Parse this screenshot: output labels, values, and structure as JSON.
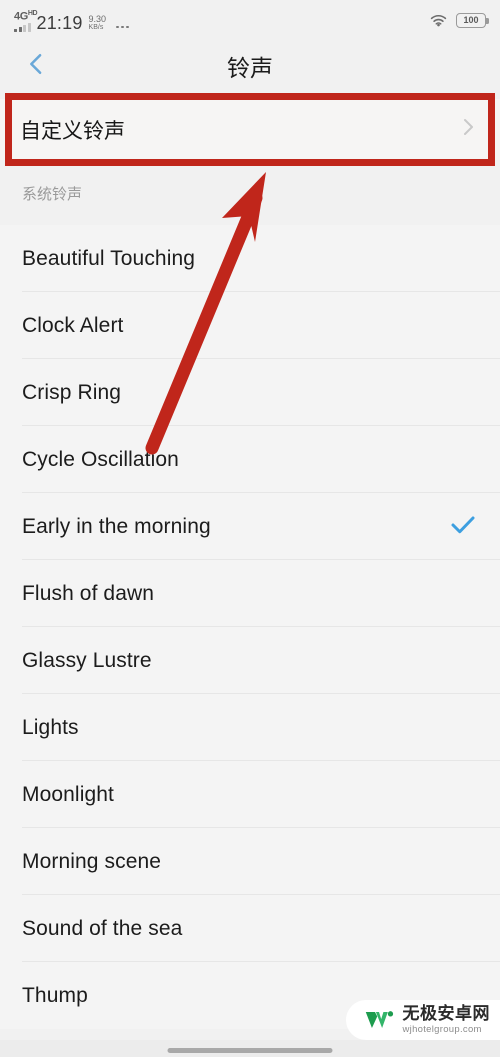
{
  "status_bar": {
    "network_type": "4G",
    "network_suffix": "HD",
    "time": "21:19",
    "speed_value": "9.30",
    "speed_unit": "KB/s",
    "overflow_icon": "more-dots-icon",
    "wifi_icon": "wifi-icon",
    "battery_level": "100"
  },
  "header": {
    "back_icon": "chevron-left-icon",
    "title": "铃声"
  },
  "custom_ringtone": {
    "label": "自定义铃声",
    "chevron_icon": "chevron-right-icon"
  },
  "section": {
    "header": "系统铃声"
  },
  "ringtones": [
    {
      "name": "Beautiful Touching",
      "selected": false
    },
    {
      "name": "Clock Alert",
      "selected": false
    },
    {
      "name": "Crisp Ring",
      "selected": false
    },
    {
      "name": "Cycle Oscillation",
      "selected": false
    },
    {
      "name": "Early in the morning",
      "selected": true
    },
    {
      "name": "Flush of dawn",
      "selected": false
    },
    {
      "name": "Glassy Lustre",
      "selected": false
    },
    {
      "name": "Lights",
      "selected": false
    },
    {
      "name": "Moonlight",
      "selected": false
    },
    {
      "name": "Morning scene",
      "selected": false
    },
    {
      "name": "Sound of the sea",
      "selected": false
    },
    {
      "name": "Thump",
      "selected": false
    }
  ],
  "annotations": {
    "highlight_box_color": "#c0261b",
    "arrow_color": "#c0261b",
    "arrow_target": "自定义铃声"
  },
  "watermark": {
    "logo_icon": "w-logo-icon",
    "site_name": "无极安卓网",
    "url": "wjhotelgroup.com",
    "logo_color": "#26a65b"
  },
  "colors": {
    "page_background": "#f1f1f1",
    "row_background": "#f4f4f4",
    "accent_check": "#3d9fe0",
    "back_chevron": "#6aa8d8",
    "section_header_text": "#9a9a9a",
    "divider": "#e6e6e6"
  },
  "nav_bar": {
    "home_indicator": "home-indicator"
  }
}
